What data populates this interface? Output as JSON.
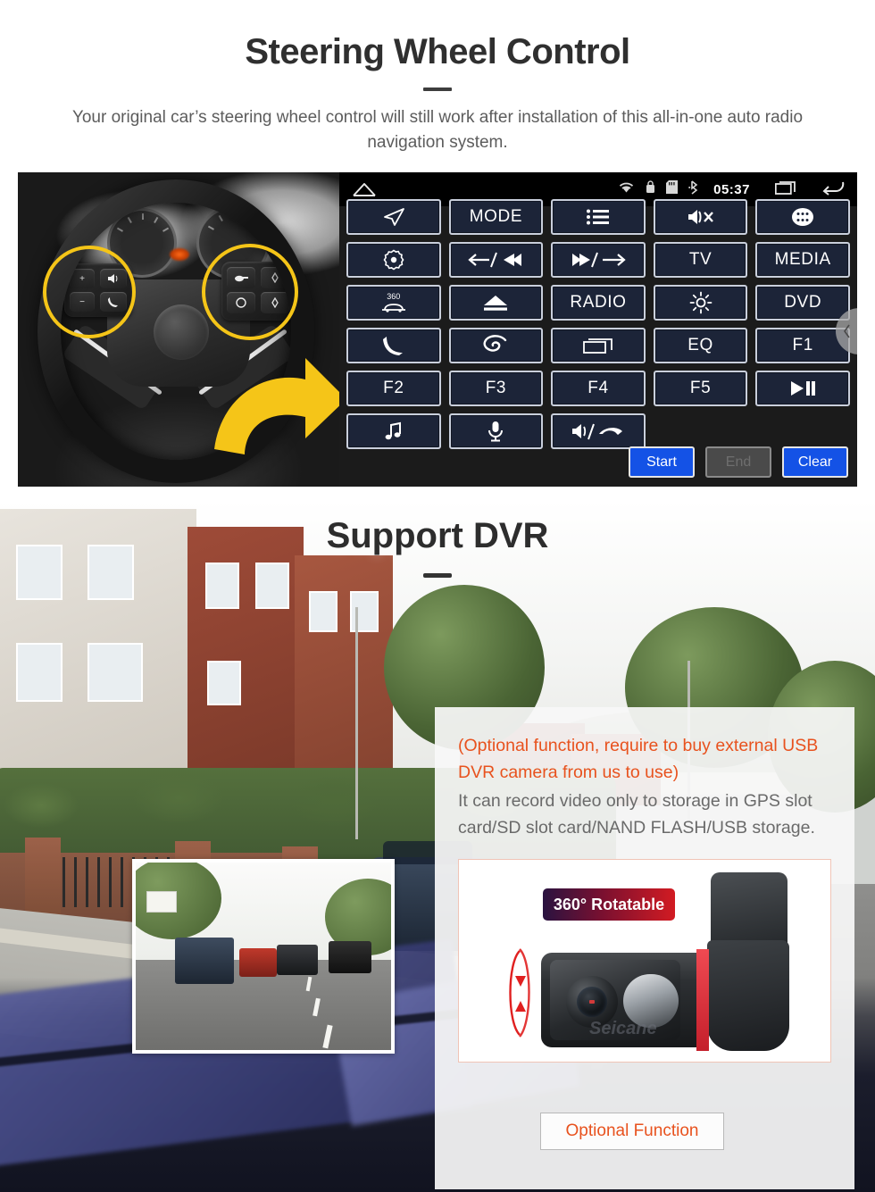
{
  "section1": {
    "title": "Steering Wheel Control",
    "subtitle": "Your original car’s steering wheel control will still work after installation of this all-in-one auto radio navigation system.",
    "head_unit": {
      "status_bar": {
        "home_icon": "home-icon",
        "wifi_icon": "wifi-icon",
        "lock_icon": "lock-icon",
        "sdcard_icon": "sd-card-icon",
        "bluetooth_icon": "bluetooth-icon",
        "clock": "05:37",
        "recents_icon": "recents-icon",
        "back_icon": "back-icon"
      },
      "buttons": [
        {
          "label": "",
          "icon": "navigation-arrow-icon",
          "name": "swc-navigation"
        },
        {
          "label": "MODE",
          "icon": "",
          "name": "swc-mode"
        },
        {
          "label": "",
          "icon": "list-menu-icon",
          "name": "swc-list"
        },
        {
          "label": "",
          "icon": "mute-icon",
          "name": "swc-mute"
        },
        {
          "label": "",
          "icon": "apps-grid-icon",
          "name": "swc-apps"
        },
        {
          "label": "",
          "icon": "power-settings-icon",
          "name": "swc-power"
        },
        {
          "label": "",
          "icon": "prev-track-icon",
          "name": "swc-prev"
        },
        {
          "label": "",
          "icon": "next-track-icon",
          "name": "swc-next"
        },
        {
          "label": "TV",
          "icon": "",
          "name": "swc-tv"
        },
        {
          "label": "MEDIA",
          "icon": "",
          "name": "swc-media"
        },
        {
          "label": "360",
          "icon": "camera-360-icon",
          "name": "swc-360"
        },
        {
          "label": "",
          "icon": "eject-icon",
          "name": "swc-eject"
        },
        {
          "label": "RADIO",
          "icon": "",
          "name": "swc-radio"
        },
        {
          "label": "",
          "icon": "brightness-icon",
          "name": "swc-brightness"
        },
        {
          "label": "DVD",
          "icon": "",
          "name": "swc-dvd"
        },
        {
          "label": "",
          "icon": "phone-icon",
          "name": "swc-phone"
        },
        {
          "label": "",
          "icon": "swirl-icon",
          "name": "swc-swirl"
        },
        {
          "label": "",
          "icon": "screen-icon",
          "name": "swc-screen"
        },
        {
          "label": "EQ",
          "icon": "",
          "name": "swc-eq"
        },
        {
          "label": "F1",
          "icon": "",
          "name": "swc-f1"
        },
        {
          "label": "F2",
          "icon": "",
          "name": "swc-f2"
        },
        {
          "label": "F3",
          "icon": "",
          "name": "swc-f3"
        },
        {
          "label": "F4",
          "icon": "",
          "name": "swc-f4"
        },
        {
          "label": "F5",
          "icon": "",
          "name": "swc-f5"
        },
        {
          "label": "",
          "icon": "play-pause-icon",
          "name": "swc-playpause"
        },
        {
          "label": "",
          "icon": "music-note-icon",
          "name": "swc-music"
        },
        {
          "label": "",
          "icon": "microphone-icon",
          "name": "swc-mic"
        },
        {
          "label": "",
          "icon": "volume-hangup-icon",
          "name": "swc-volume-hangup"
        }
      ],
      "actions": {
        "start": "Start",
        "end": "End",
        "clear": "Clear"
      },
      "scroll_handle_icon": "chevron-left-icon"
    }
  },
  "section2": {
    "title": "Support DVR",
    "note_orange": "(Optional function, require to buy external USB DVR camera from us to use)",
    "note_gray": "It can record video only to storage in GPS slot card/SD slot card/NAND FLASH/USB storage.",
    "badge": "360° Rotatable",
    "brand": "Seicane",
    "optional_button": "Optional Function"
  },
  "colors": {
    "orange": "#e8521e",
    "blue_button": "#1452e6",
    "panel_navy": "#1c2438",
    "highlight_yellow": "#f5c518",
    "badge_red": "#d21b22",
    "text_dark": "#2d2d2d",
    "text_gray": "#6a6a6a"
  }
}
